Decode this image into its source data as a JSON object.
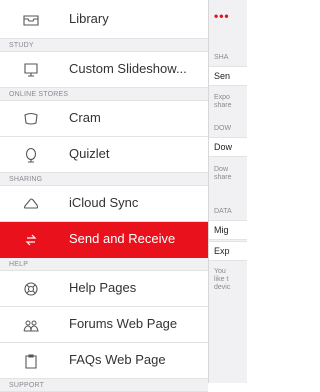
{
  "sidebar": {
    "top_item": {
      "label": "Library",
      "icon": "inbox-tray-icon"
    },
    "sections": {
      "study": "STUDY",
      "online_stores": "ONLINE STORES",
      "sharing": "SHARING",
      "help": "HELP",
      "support": "SUPPORT"
    },
    "items": {
      "custom_slideshow": {
        "label": "Custom Slideshow...",
        "icon": "presentation-screen-icon"
      },
      "cram": {
        "label": "Cram",
        "icon": "cram-cylinder-icon"
      },
      "quizlet": {
        "label": "Quizlet",
        "icon": "quizlet-q-icon"
      },
      "icloud_sync": {
        "label": "iCloud Sync",
        "icon": "cloud-icon"
      },
      "send_receive": {
        "label": "Send and Receive",
        "icon": "transfer-arrows-icon"
      },
      "help_pages": {
        "label": "Help Pages",
        "icon": "life-ring-icon"
      },
      "forums_web_page": {
        "label": "Forums Web Page",
        "icon": "people-group-icon"
      },
      "faqs_web_page": {
        "label": "FAQs Web Page",
        "icon": "clipboard-icon"
      }
    },
    "accent_color": "#e8111c"
  },
  "detail": {
    "more_glyph": "•••",
    "headers": [
      "SHA",
      "DOW",
      "DATA"
    ],
    "cells": [
      "Sen",
      "Dow",
      "Mig",
      "Exp"
    ],
    "notes": {
      "share_note": [
        "Expo",
        "share"
      ],
      "download_note": [
        "Dow",
        "share"
      ],
      "data_note": [
        "You",
        "like t",
        "devic"
      ]
    }
  }
}
